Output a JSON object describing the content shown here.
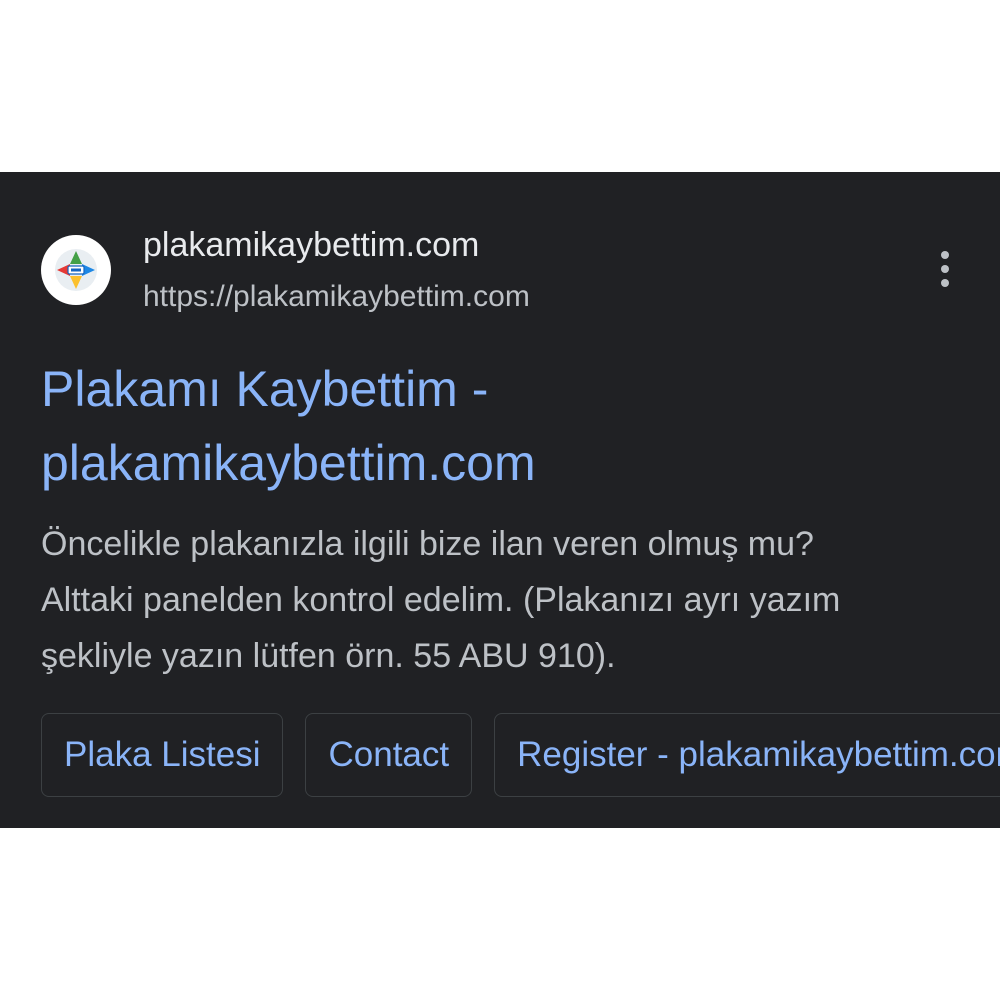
{
  "result": {
    "site_name": "plakamikaybettim.com",
    "site_url": "https://plakamikaybettim.com",
    "title_line1": "Plakamı Kaybettim -",
    "title_line2": "plakamikaybettim.com",
    "snippet_line1": "Öncelikle plakanızla ilgili bize ilan veren olmuş mu?",
    "snippet_line2": "Alttaki panelden kontrol edelim. (Plakanızı ayrı yazım",
    "snippet_line3": "şekliyle yazın lütfen örn. 55 ABU 910).",
    "favicon_icon": "site-logo-icon",
    "more_icon": "more-vert-icon"
  },
  "sitelinks": [
    {
      "label": "Plaka Listesi"
    },
    {
      "label": "Contact"
    },
    {
      "label": "Register - plakamikaybettim.com"
    }
  ],
  "colors": {
    "background": "#202124",
    "link": "#8ab4f8",
    "primary_text": "#e8eaed",
    "secondary_text": "#bdc1c6",
    "chip_border": "#3c4043"
  }
}
